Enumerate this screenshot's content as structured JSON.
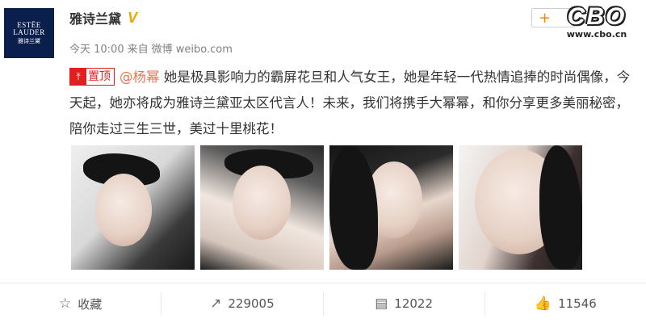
{
  "author": {
    "avatar_lines": [
      "ESTĒE",
      "LAUDER",
      "雅诗兰黛"
    ],
    "name": "雅诗兰黛",
    "verified_icon": "V"
  },
  "meta": {
    "time": "今天 10:00",
    "source_prefix": "来自",
    "source": "微博 weibo.com"
  },
  "follow": {
    "label": "+"
  },
  "watermark": {
    "mark": "CBO",
    "url": "www.cbo.cn"
  },
  "post": {
    "pin_label": "置顶",
    "mention": "@杨幂",
    "text": " 她是极具影响力的霸屏花旦和人气女王，她是年轻一代热情追捧的时尚偶像，今天起，她亦将成为雅诗兰黛亚太区代言人！未来，我们将携手大幂幂，和你分享更多美丽秘密，陪你走过三生三世，美过十里桃花！"
  },
  "photos": [
    {
      "name": "photo-1"
    },
    {
      "name": "photo-2"
    },
    {
      "name": "photo-3"
    },
    {
      "name": "photo-4"
    }
  ],
  "actions": {
    "favorite_label": "收藏",
    "repost_count": "229005",
    "comment_count": "12022",
    "like_count": "11546"
  },
  "icons": {
    "favorite": "star-icon",
    "repost": "repost-icon",
    "comment": "comment-icon",
    "like": "thumbs-up-icon",
    "pin": "pin-icon"
  },
  "colors": {
    "mention": "#eb7350",
    "pin": "#e02020",
    "verified": "#f3a300",
    "follow": "#ff8200"
  }
}
